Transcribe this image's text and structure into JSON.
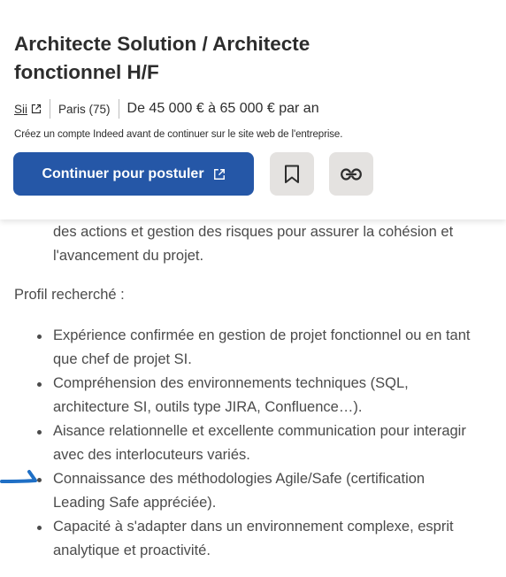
{
  "job": {
    "title": "Architecte Solution / Architecte fonctionnel H/F",
    "company": "Sii",
    "location": "Paris (75)",
    "salary": "De 45 000 € à 65 000 € par an",
    "notice": "Créez un compte Indeed avant de continuer sur le site web de l'entreprise."
  },
  "actions": {
    "apply_label": "Continuer pour postuler",
    "icons": {
      "close": "close-icon",
      "external": "external-link-icon",
      "save": "bookmark-icon",
      "copy": "link-icon"
    }
  },
  "description": {
    "continued_text": "des actions et gestion des risques pour assurer la cohésion et l'avancement du projet.",
    "profile_heading": "Profil recherché :",
    "requirements": [
      "Expérience confirmée en gestion de projet fonctionnel ou en tant que chef de projet SI.",
      "Compréhension des environnements techniques (SQL, architecture SI, outils type JIRA, Confluence…).",
      "Aisance relationnelle et excellente communication pour interagir avec des interlocuteurs variés.",
      "Connaissance des méthodologies Agile/Safe (certification Leading Safe appréciée).",
      "Capacité à s'adapter dans un environnement complexe, esprit analytique et proactivité."
    ]
  },
  "colors": {
    "primary": "#2557a7",
    "icon_button_bg": "#e4e2e0",
    "text": "#2d2d2d",
    "body_text": "#4b4b4b",
    "pointer": "#1f6fc5"
  }
}
